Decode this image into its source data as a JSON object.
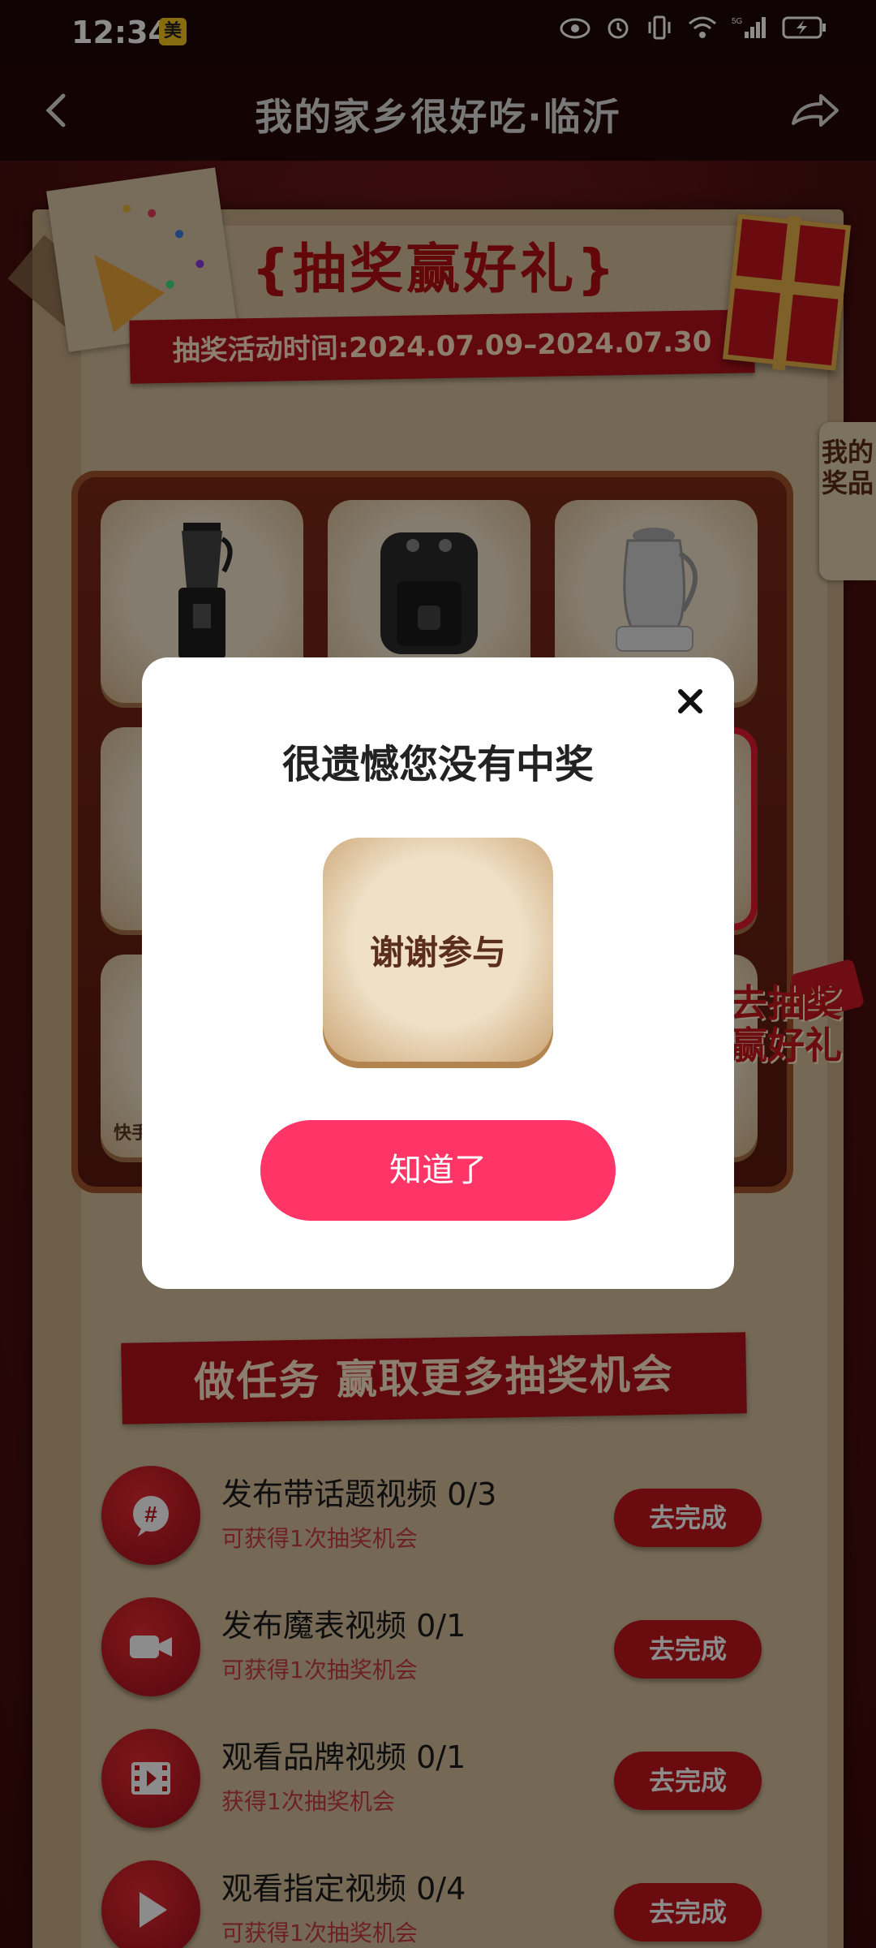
{
  "status_bar": {
    "time": "12:34",
    "mei_badge": "美",
    "network": "5G"
  },
  "header": {
    "title": "我的家乡很好吃·临沂"
  },
  "lottery": {
    "title": "{抽奖赢好礼}",
    "date_range": "抽奖活动时间:2024.07.09–2024.07.30",
    "my_prizes": "我的奖品",
    "side_promo": [
      "去抽奖",
      "赢好礼"
    ],
    "partial_tile_label": "快手"
  },
  "tasks": {
    "banner": "做任务 赢取更多抽奖机会",
    "items": [
      {
        "title": "发布带话题视频",
        "progress": "0/3",
        "subtitle": "可获得1次抽奖机会",
        "button": "去完成",
        "icon": "hashtag-chat-icon"
      },
      {
        "title": "发布魔表视频",
        "progress": "0/1",
        "subtitle": "可获得1次抽奖机会",
        "button": "去完成",
        "icon": "video-camera-icon"
      },
      {
        "title": "观看品牌视频",
        "progress": "0/1",
        "subtitle": "获得1次抽奖机会",
        "button": "去完成",
        "icon": "film-icon"
      },
      {
        "title": "观看指定视频",
        "progress": "0/4",
        "subtitle": "可获得1次抽奖机会",
        "button": "去完成",
        "icon": "play-icon"
      }
    ]
  },
  "modal": {
    "title": "很遗憾您没有中奖",
    "prize_text": "谢谢参与",
    "confirm_button": "知道了"
  },
  "colors": {
    "accent": "#fe3566",
    "red": "#c1141c",
    "paper": "#d5bf9d"
  }
}
